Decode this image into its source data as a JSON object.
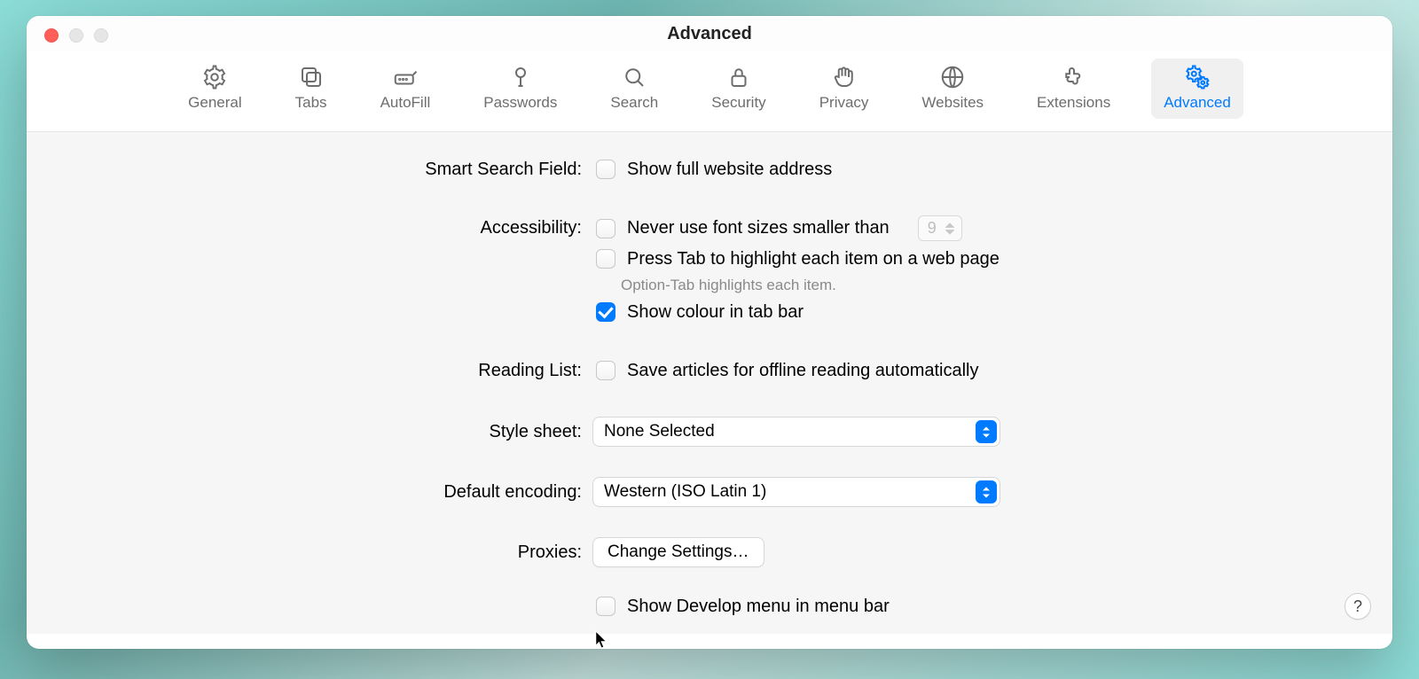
{
  "window": {
    "title": "Advanced"
  },
  "toolbar": {
    "tabs": [
      {
        "label": "General"
      },
      {
        "label": "Tabs"
      },
      {
        "label": "AutoFill"
      },
      {
        "label": "Passwords"
      },
      {
        "label": "Search"
      },
      {
        "label": "Security"
      },
      {
        "label": "Privacy"
      },
      {
        "label": "Websites"
      },
      {
        "label": "Extensions"
      },
      {
        "label": "Advanced"
      }
    ],
    "active_index": 9
  },
  "sections": {
    "smart_search": {
      "label": "Smart Search Field:",
      "show_full_address": {
        "text": "Show full website address",
        "checked": false
      }
    },
    "accessibility": {
      "label": "Accessibility:",
      "min_font": {
        "text": "Never use font sizes smaller than",
        "checked": false,
        "value": "9"
      },
      "press_tab": {
        "text": "Press Tab to highlight each item on a web page",
        "checked": false
      },
      "hint": "Option-Tab highlights each item.",
      "show_colour": {
        "text": "Show colour in tab bar",
        "checked": true
      }
    },
    "reading_list": {
      "label": "Reading List:",
      "save_offline": {
        "text": "Save articles for offline reading automatically",
        "checked": false
      }
    },
    "style_sheet": {
      "label": "Style sheet:",
      "value": "None Selected"
    },
    "default_encoding": {
      "label": "Default encoding:",
      "value": "Western (ISO Latin 1)"
    },
    "proxies": {
      "label": "Proxies:",
      "button": "Change Settings…"
    },
    "develop": {
      "text": "Show Develop menu in menu bar",
      "checked": false
    }
  },
  "help": "?"
}
